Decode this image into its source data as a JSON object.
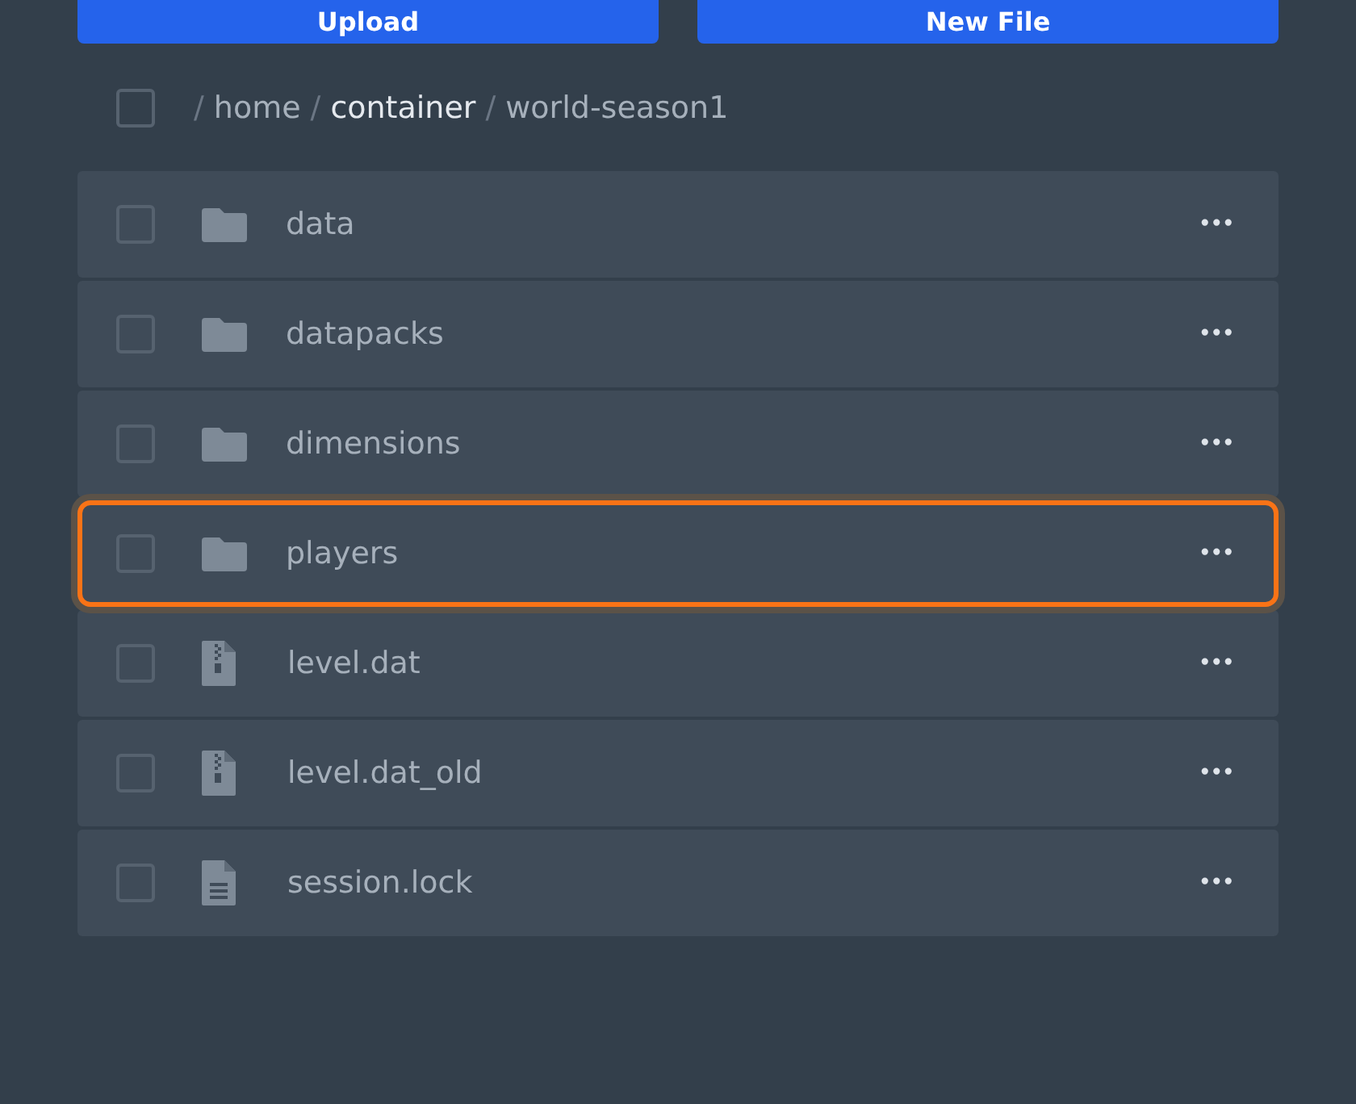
{
  "actions": [
    {
      "label": "Upload"
    },
    {
      "label": "New File"
    }
  ],
  "breadcrumb": {
    "checked": false,
    "segments": [
      {
        "separator": "/",
        "label": "home",
        "emphasized": false
      },
      {
        "separator": "/",
        "label": "container",
        "emphasized": true
      },
      {
        "separator": "/",
        "label": "world-season1",
        "emphasized": false
      }
    ]
  },
  "files": [
    {
      "name": "data",
      "kind": "folder",
      "checked": false,
      "highlighted": false,
      "menu": "•••"
    },
    {
      "name": "datapacks",
      "kind": "folder",
      "checked": false,
      "highlighted": false,
      "menu": "•••"
    },
    {
      "name": "dimensions",
      "kind": "folder",
      "checked": false,
      "highlighted": false,
      "menu": "•••"
    },
    {
      "name": "players",
      "kind": "folder",
      "checked": false,
      "highlighted": true,
      "menu": "•••"
    },
    {
      "name": "level.dat",
      "kind": "archive",
      "checked": false,
      "highlighted": false,
      "menu": "•••"
    },
    {
      "name": "level.dat_old",
      "kind": "archive",
      "checked": false,
      "highlighted": false,
      "menu": "•••"
    },
    {
      "name": "session.lock",
      "kind": "text",
      "checked": false,
      "highlighted": false,
      "menu": "•••"
    }
  ]
}
